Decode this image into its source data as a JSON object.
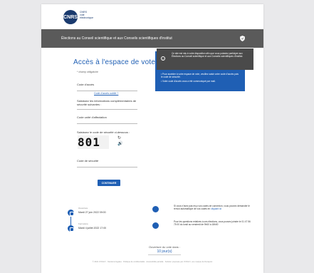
{
  "header": {
    "logo_initials": "CNRS",
    "logo_lines": [
      "CNRS",
      "vote",
      "électronique"
    ]
  },
  "banner": {
    "title": "Élections au Conseil scientifique et aux Conseils scientifiques d'institut"
  },
  "login": {
    "title": "Accès à l'espace de vote",
    "required_note": "* champ obligatoire",
    "access_code_label": "Code d'accès",
    "forgot_link": "Code d'accès oublié ?",
    "security_info_label": "Saisissez les informations complémentaires de sécurité suivantes :",
    "unit_code_label": "Code unité d'affectation",
    "captcha_label": "Saisissez le code de sécurité ci-dessous :",
    "captcha_text": "801",
    "security_code_label": "Code de sécurité",
    "continue_label": "CONTINUER"
  },
  "info": {
    "notice": "Ce site est mis à votre disposition afin que vous puissiez participer aux Élections au Conseil scientifique et aux Conseils scientifiques d'institut.",
    "bullets": [
      "Pour accéder à votre espace de vote, veuillez saisir votre code d'accès puis le code de sécurité.",
      "Votre code d'accès vous a été communiqué par mail."
    ]
  },
  "dates": {
    "open_label": "Ouverture",
    "open_value": "Mardi 27 juin 2022 09:00",
    "close_label": "Fermeture",
    "close_value": "Mardi 4 juillet 2022 17:00"
  },
  "help": {
    "lost_code": "Si vous n'avez pas reçu vos codes de connexion, vous pouvez demander le renvoi automatique de vos codes en",
    "lost_code_link": "cliquant ici",
    "phone": "Pour les questions relatives à ces élections, vous pouvez joindre le 01 47 56 75 00 du lundi au vendredi de 9h00 à 18h00"
  },
  "countdown": {
    "label": "Ouverture du vote dans :",
    "value": "10 jour(s)"
  },
  "footer": {
    "text": "© 2022 VOXALY · Mentions légales · Politique de confidentialité · Accessibilité partielle · Solution proposée par VOXALY, une marque de Docapost"
  }
}
